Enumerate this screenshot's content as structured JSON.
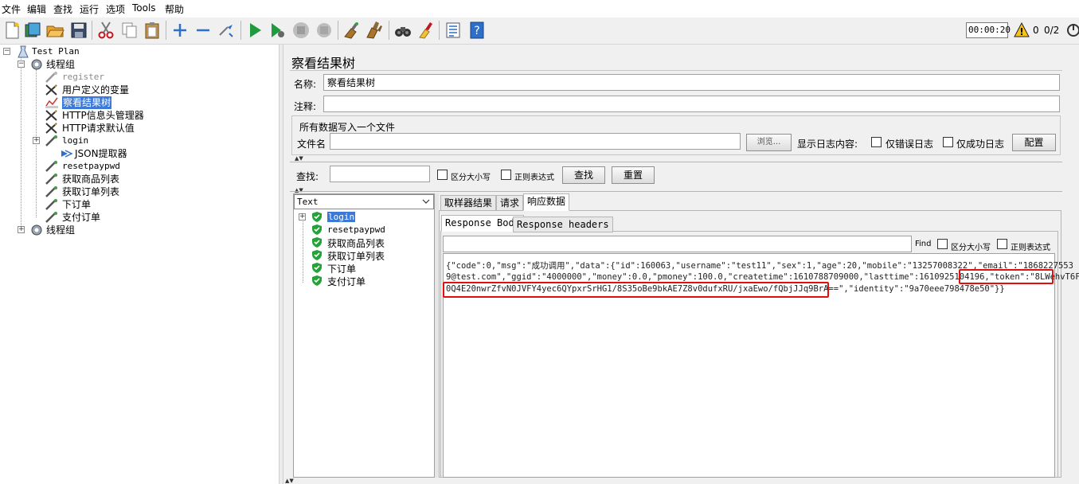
{
  "menu": [
    "文件",
    "编辑",
    "查找",
    "运行",
    "选项",
    "Tools",
    "帮助"
  ],
  "toolbar": {
    "timer": "00:00:20",
    "warning_count": "0",
    "thread_count": "0/2"
  },
  "tree": {
    "root": "Test Plan",
    "thread_group_1": "线程组",
    "items": [
      {
        "label": "register",
        "mono": true,
        "disabled": true
      },
      {
        "label": "用户定义的变量"
      },
      {
        "label": "察看结果树",
        "selected": true
      },
      {
        "label": "HTTP信息头管理器"
      },
      {
        "label": "HTTP请求默认值"
      },
      {
        "label": "login",
        "mono": true
      },
      {
        "label": "JSON提取器"
      },
      {
        "label": "resetpaypwd",
        "mono": true
      },
      {
        "label": "获取商品列表"
      },
      {
        "label": "获取订单列表"
      },
      {
        "label": "下订单"
      },
      {
        "label": "支付订单"
      }
    ],
    "thread_group_2": "线程组"
  },
  "panel": {
    "title": "察看结果树",
    "name_label": "名称:",
    "name_value": "察看结果树",
    "comment_label": "注释:",
    "file_section_title": "所有数据写入一个文件",
    "filename_label": "文件名",
    "browse_button": "浏览...",
    "log_content_label": "显示日志内容:",
    "only_errors_label": "仅错误日志",
    "only_success_label": "仅成功日志",
    "config_button": "配置",
    "search_label": "查找:",
    "case_sensitive_label": "区分大小写",
    "regex_label": "正则表达式",
    "search_button": "查找",
    "reset_button": "重置"
  },
  "results": {
    "renderer": "Text",
    "samples": [
      "login",
      "resetpaypwd",
      "获取商品列表",
      "获取订单列表",
      "下订单",
      "支付订单"
    ],
    "tabs": [
      "取样器结果",
      "请求",
      "响应数据"
    ],
    "subtabs": [
      "Response Body",
      "Response headers"
    ],
    "find_label": "Find",
    "find_case_label": "区分大小写",
    "find_regex_label": "正则表达式",
    "body_line1": "{\"code\":0,\"msg\":\"成功调用\",\"data\":{\"id\":160063,\"username\":\"test11\",\"sex\":1,\"age\":20,\"mobile\":\"13257008322\",\"email\":\"1868227553",
    "body_line2": "9@test.com\",\"ggid\":\"4000000\",\"money\":0.0,\"pmoney\":100.0,\"createtime\":1610788709000,\"lasttime\":1610925104196,\"token\":\"8LWehvT6F",
    "body_line3": "0Q4E20nwrZfvN0JVFY4yec6QYpxrSrHG1/8S35oBe9bkAE7Z8v0dufxRU/jxaEwo/fQbjJJq9BrA==\",\"identity\":\"9a70eee798478e50\"}}"
  }
}
